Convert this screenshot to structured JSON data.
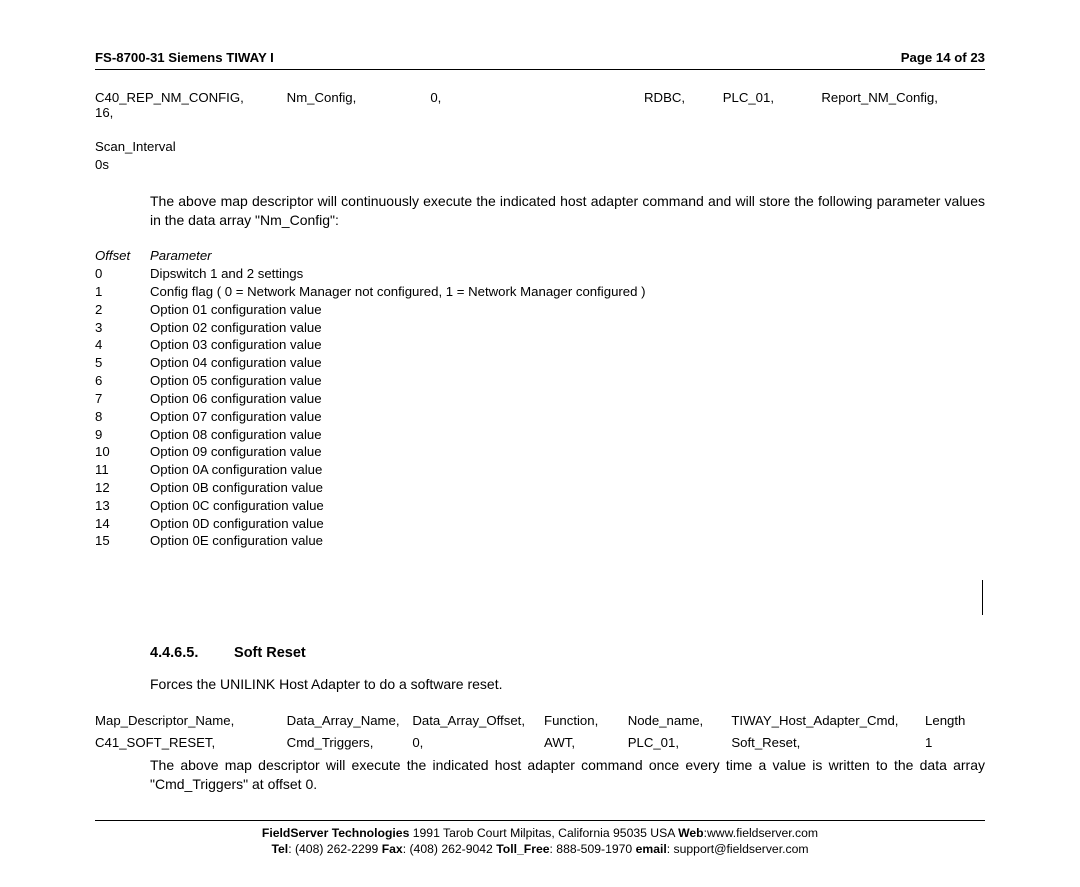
{
  "header": {
    "doc_id": "FS-8700-31 Siemens TIWAY I",
    "page": "Page 14 of 23"
  },
  "config_row": {
    "c0": "C40_REP_NM_CONFIG,",
    "c1": "Nm_Config,",
    "c2": "0,",
    "c3": "RDBC,",
    "c4": "PLC_01,",
    "c5": "Report_NM_Config,",
    "c6": "16,"
  },
  "scan": {
    "l0": "Scan_Interval",
    "l1": "0s"
  },
  "para1": "The above map descriptor will continuously execute the indicated host adapter command and will store the following parameter values in the data array \"Nm_Config\":",
  "param_header": {
    "offset": "Offset",
    "param": "Parameter"
  },
  "params": [
    {
      "o": "0",
      "p": "Dipswitch 1 and 2 settings"
    },
    {
      "o": "1",
      "p": "Config flag ( 0 = Network Manager not configured, 1 = Network Manager configured )"
    },
    {
      "o": "2",
      "p": "Option 01 configuration value"
    },
    {
      "o": "3",
      "p": "Option 02 configuration value"
    },
    {
      "o": "4",
      "p": "Option 03 configuration value"
    },
    {
      "o": "5",
      "p": "Option 04 configuration value"
    },
    {
      "o": "6",
      "p": "Option 05 configuration value"
    },
    {
      "o": "7",
      "p": "Option 06 configuration value"
    },
    {
      "o": "8",
      "p": "Option 07 configuration value"
    },
    {
      "o": "9",
      "p": "Option 08 configuration value"
    },
    {
      "o": "10",
      "p": "Option 09 configuration value"
    },
    {
      "o": "11",
      "p": "Option 0A configuration value"
    },
    {
      "o": "12",
      "p": "Option 0B configuration value"
    },
    {
      "o": "13",
      "p": "Option 0C configuration value"
    },
    {
      "o": "14",
      "p": "Option 0D configuration value"
    },
    {
      "o": "15",
      "p": "Option 0E configuration value"
    }
  ],
  "section": {
    "num": "4.4.6.5.",
    "title": "Soft Reset"
  },
  "para2": "Forces the UNILINK Host Adapter to do a software reset.",
  "map_header": {
    "c0": "Map_Descriptor_Name,",
    "c1": "Data_Array_Name,",
    "c2": "Data_Array_Offset,",
    "c3": "Function,",
    "c4": "Node_name,",
    "c5": "TIWAY_Host_Adapter_Cmd,",
    "c6": "Length"
  },
  "map_row": {
    "c0": "C41_SOFT_RESET,",
    "c1": "Cmd_Triggers,",
    "c2": "0,",
    "c3": "AWT,",
    "c4": "PLC_01,",
    "c5": "Soft_Reset,",
    "c6": "1"
  },
  "para3": "The above map descriptor will execute the indicated host adapter command once every time a value is written to the data array \"Cmd_Triggers\" at offset 0.",
  "footer": {
    "company": "FieldServer Technologies",
    "addr": " 1991 Tarob Court Milpitas, California 95035 USA  ",
    "web_l": "Web",
    "web_v": ":www.fieldserver.com",
    "tel_l": "Tel",
    "tel_v": ": (408) 262-2299  ",
    "fax_l": "Fax",
    "fax_v": ": (408) 262-9042  ",
    "toll_l": "Toll_Free",
    "toll_v": ": 888-509-1970  ",
    "email_l": "email",
    "email_v": ": support@fieldserver.com"
  }
}
